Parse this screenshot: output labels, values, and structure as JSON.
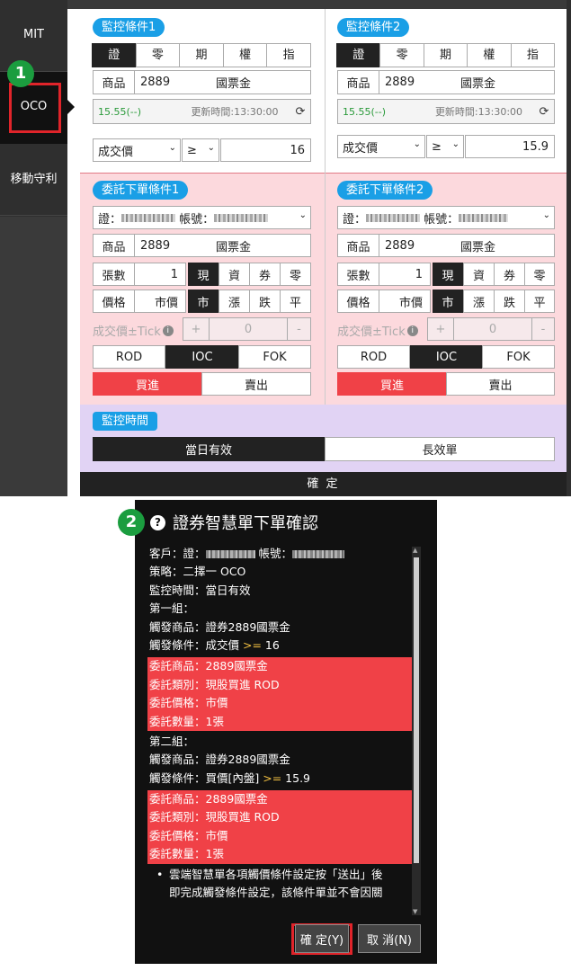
{
  "sidebar": {
    "items": [
      "MIT",
      "OCO",
      "移動守利"
    ]
  },
  "badges": [
    "1",
    "2"
  ],
  "monitor": {
    "cond1_title": "監控條件1",
    "cond2_title": "監控條件2",
    "tabs": [
      "證",
      "零",
      "期",
      "權",
      "指"
    ],
    "product_label": "商品",
    "code": "2889",
    "name": "國票金",
    "quote_price": "15.55(--)",
    "quote_time": "更新時間:13:30:00",
    "refresh_icon": "⟳",
    "field": "成交價",
    "op": "≥",
    "value1": "16",
    "value2": "15.9"
  },
  "order": {
    "title1": "委託下單條件1",
    "title2": "委託下單條件2",
    "account_prefix": "證：",
    "account_mid": "帳號：",
    "product_label": "商品",
    "code": "2889",
    "name": "國票金",
    "qty_label": "張數",
    "qty": "1",
    "qty_types": [
      "現",
      "資",
      "券",
      "零"
    ],
    "price_label": "價格",
    "price_val": "市價",
    "price_types": [
      "市",
      "漲",
      "跌",
      "平"
    ],
    "tick_label": "成交價±Tick",
    "tick_minus": "-",
    "tick_plus": "+",
    "tick_val": "0",
    "tif": [
      "ROD",
      "IOC",
      "FOK"
    ],
    "buy": "買進",
    "sell": "賣出"
  },
  "period": {
    "title": "監控時間",
    "options": [
      "當日有效",
      "長效單"
    ]
  },
  "confirm_label": "確 定",
  "dialog": {
    "title": "證券智慧單下單確認",
    "customer_prefix": "客戶：證：",
    "customer_mid": "帳號：",
    "strategy": "策略：二擇一 OCO",
    "period": "監控時間：當日有效",
    "group1": "第一組：",
    "g1_product": "觸發商品：證券2889國票金",
    "g1_cond_pre": "觸發條件：成交價 ",
    "g1_cond_op": ">=",
    "g1_cond_val": " 16",
    "g1_order": [
      "委託商品：2889國票金",
      "委託類別：現股買進 ROD",
      "委託價格：市價",
      "委託數量：1張"
    ],
    "group2": "第二組：",
    "g2_product": "觸發商品：證券2889國票金",
    "g2_cond_pre": "觸發條件：買價[內盤] ",
    "g2_cond_op": ">=",
    "g2_cond_val": " 15.9",
    "g2_order": [
      "委託商品：2889國票金",
      "委託類別：現股買進 ROD",
      "委託價格：市價",
      "委託數量：1張"
    ],
    "note_line1": "雲端智慧單各項觸價條件設定按「送出」後",
    "note_line2": "即完成觸發條件設定，該條件單並不會因關",
    "ok": "確 定(Y)",
    "cancel": "取 消(N)"
  }
}
